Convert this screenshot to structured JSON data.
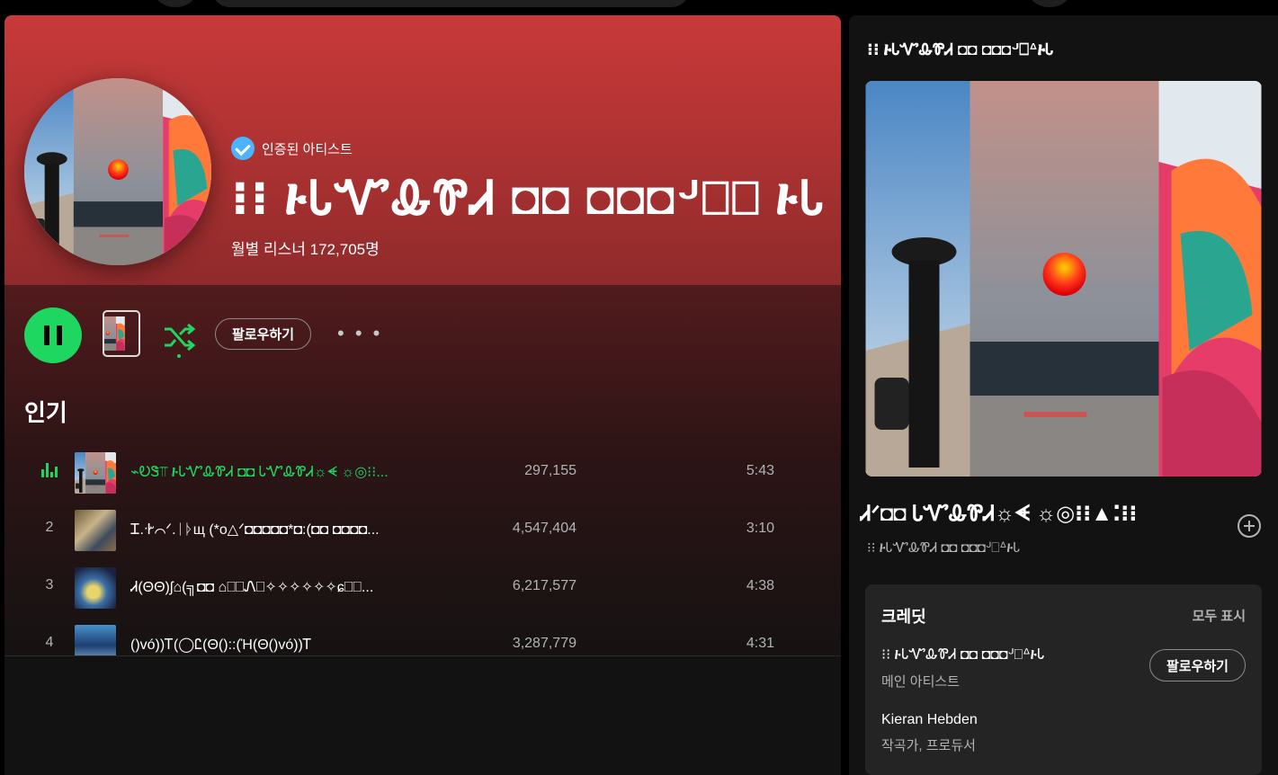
{
  "artist": {
    "verified_label": "인증된 아티스트",
    "name": "⁝⁝ ᎙ᏓᏉᎲᏈᏗ ◘◘ ◘◘◘ᒢ⎕⎕ ᎙Ꮣ",
    "monthly_listeners": "월별 리스너 172,705명"
  },
  "controls": {
    "follow_label": "팔로우하기",
    "more_label": "• • •"
  },
  "popular": {
    "section_title": "인기",
    "tracks": [
      {
        "num": "1",
        "title": "⌁ᎧᏕ⫪ ᎙ᏓᏉᎲᏈᏗ ◘◘ ᏓᏉᎲᏈᏗ☼ᗛ ☼◎⁝⁝...",
        "plays": "297,155",
        "duration": "5:43",
        "playing": true
      },
      {
        "num": "2",
        "title": "Ꮖ.ᐧᎨ⌒ᐟ.ᛁᚦщ (*ᴏ△ᐟ◘◘◘◘◘*◘:(◘◘ ◘◘◘◘...",
        "plays": "4,547,404",
        "duration": "3:10",
        "playing": false
      },
      {
        "num": "3",
        "title": "Ꮧ(ΘΘ)ʃ⌂(╗◘◘ ⌂⎕⎕Ꮑ⎕✧✧✧✧✧✧ɕ⎕⎕...",
        "plays": "6,217,577",
        "duration": "4:38",
        "playing": false
      },
      {
        "num": "4",
        "title": "()vó))Ꭲ(◯Ꮭ(Θ()::(Ἡ(Θ()vó))Ꭲ",
        "plays": "3,287,779",
        "duration": "4:31",
        "playing": false
      }
    ]
  },
  "now_playing": {
    "header": "⁝⁝ ᎙ᏓᏉᎲᏈᏗ ◘◘ ◘◘◘ᒢ⎕ᐞ᎙Ꮣ",
    "title": "Ꮧᐟ◘◘ ᏓᏉᎲᏈᏗ☼ᗛ ☼◎⁝⁝▲⁚⁝⁝",
    "artist": "⁝⁝ ᎙ᏓᏉᎲᏈᏗ ◘◘ ◘◘◘ᒢ⎕ᐞ᎙Ꮣ"
  },
  "credits": {
    "title": "크레딧",
    "show_all": "모두 표시",
    "entries": [
      {
        "name": "⁝⁝ ᎙ᏓᏉᎲᏈᏗ ◘◘ ◘◘◘ᒢ⎕ᐞ᎙Ꮣ",
        "role": "메인 아티스트",
        "follow_label": "팔로우하기"
      },
      {
        "name": "Kieran Hebden",
        "role": "작곡가, 프로듀서"
      }
    ]
  },
  "colors": {
    "accent": "#1ed760",
    "hero_red": "#c8393a",
    "surface": "#121212",
    "card": "#242424"
  }
}
